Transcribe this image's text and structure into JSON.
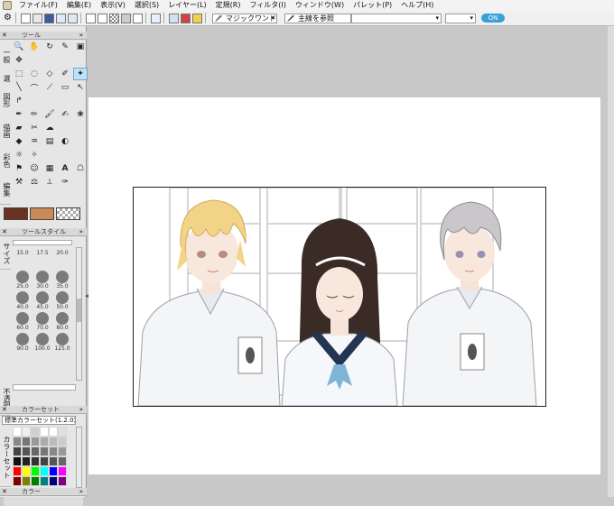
{
  "menu": [
    "ファイル(F)",
    "編集(E)",
    "表示(V)",
    "選択(S)",
    "レイヤー(L)",
    "定規(R)",
    "フィルタ(I)",
    "ウィンドウ(W)",
    "パレット(P)",
    "ヘルプ(H)"
  ],
  "toolbar": {
    "tool_select": "マジックワンド",
    "ref_select": "主線を参照",
    "badge": "ON"
  },
  "tool_panel": {
    "title": "ツール",
    "tabs": [
      "一般",
      "選",
      "図形",
      "描画",
      "彩色",
      "編集"
    ]
  },
  "tool_style": {
    "title": "ツールスタイル",
    "side_tab": "サイズ",
    "opacity_tab": "不透明",
    "sizes": [
      "15.0",
      "17.5",
      "20.0",
      "25.0",
      "30.0",
      "35.0",
      "40.0",
      "45.0",
      "50.0",
      "60.0",
      "70.0",
      "80.0",
      "90.0",
      "100.0",
      "125.0"
    ]
  },
  "colorset": {
    "title": "カラーセット",
    "select": "標準カラーセット(1.2.0)",
    "side_tab": "カラーセット",
    "palette": [
      "#ffffff",
      "#f0f0f0",
      "#cfcfcf",
      "#ffffff",
      "#ffffff",
      "#e0e0e0",
      "#888888",
      "#777777",
      "#999999",
      "#aaaaaa",
      "#bbbbbb",
      "#cccccc",
      "#444444",
      "#555555",
      "#666666",
      "#777777",
      "#888888",
      "#999999",
      "#111111",
      "#222222",
      "#333333",
      "#444444",
      "#555555",
      "#666666",
      "#ff0000",
      "#ffff00",
      "#00ff00",
      "#00ffff",
      "#0000ff",
      "#ff00ff",
      "#800000",
      "#808000",
      "#008000",
      "#008080",
      "#000080",
      "#800080"
    ]
  },
  "color_panel": {
    "title": "カラー"
  },
  "colors": {
    "main_color": "#6a3222",
    "sub_color": "#c98a58",
    "selected_tool_bg": "#bfe0f7",
    "badge_color": "#3aa0d8"
  }
}
